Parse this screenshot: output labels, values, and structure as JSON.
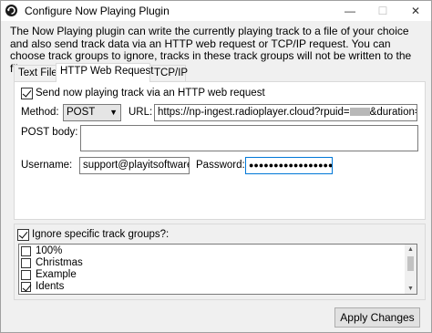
{
  "window": {
    "title": "Configure Now Playing Plugin",
    "min_glyph": "—",
    "max_glyph": "☐",
    "close_glyph": "✕"
  },
  "description": "The Now Playing plugin can write the currently playing track to a file of your choice and also send track data via an HTTP web request or TCP/IP request. You can choose track groups to ignore, tracks in these track groups will not be written to the file.",
  "tabs": [
    {
      "label": "Text File",
      "active": false
    },
    {
      "label": "HTTP Web Request",
      "active": true
    },
    {
      "label": "TCP/IP",
      "active": false
    }
  ],
  "http": {
    "send_checkbox_label": "Send now playing track via an HTTP web request",
    "send_checked": true,
    "method_label": "Method:",
    "method_value": "POST",
    "url_label": "URL:",
    "url_prefix": "https://np-ingest.radioplayer.cloud?rpuid=",
    "url_suffix": "&duration={{act",
    "post_body_label": "POST body:",
    "post_body_value": "",
    "username_label": "Username:",
    "username_value": "support@playitsoftware.co",
    "password_label": "Password:",
    "password_value": "●●●●●●●●●●●●●●●●●●●●●"
  },
  "track_groups": {
    "ignore_label": "Ignore specific track groups?:",
    "ignore_checked": true,
    "items": [
      {
        "label": "100%",
        "checked": false
      },
      {
        "label": "Christmas",
        "checked": false
      },
      {
        "label": "Example",
        "checked": false
      },
      {
        "label": "Idents",
        "checked": true
      }
    ]
  },
  "apply_button": "Apply Changes"
}
